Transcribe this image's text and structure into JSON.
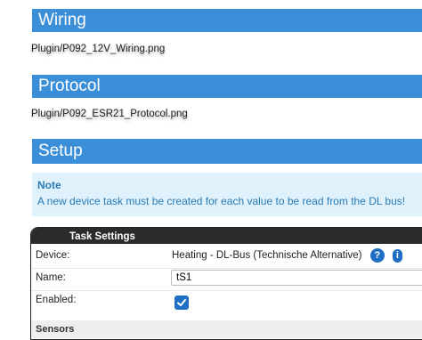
{
  "sections": {
    "wiring": {
      "title": "Wiring",
      "image_alt": "Plugin/P092_12V_Wiring.png"
    },
    "protocol": {
      "title": "Protocol",
      "image_alt": "Plugin/P092_ESR21_Protocol.png"
    },
    "setup": {
      "title": "Setup"
    }
  },
  "note": {
    "title": "Note",
    "text": "A new device task must be created for each value to be read from the DL bus!"
  },
  "task_settings": {
    "header": "Task Settings",
    "device": {
      "label": "Device:",
      "value": "Heating - DL-Bus (Technische Alternative)"
    },
    "name": {
      "label": "Name:",
      "value": "tS1"
    },
    "enabled": {
      "label": "Enabled:",
      "checked": true
    },
    "sensors_label": "Sensors"
  },
  "colors": {
    "section_header_bg": "#3b8fd9",
    "note_bg": "#dff1fb",
    "note_text": "#2a7ab3",
    "accent_blue": "#1f6fc5",
    "panel_header_bg": "#2b2b2b"
  },
  "icons": [
    "help-icon",
    "info-icon",
    "checkmark-icon"
  ]
}
